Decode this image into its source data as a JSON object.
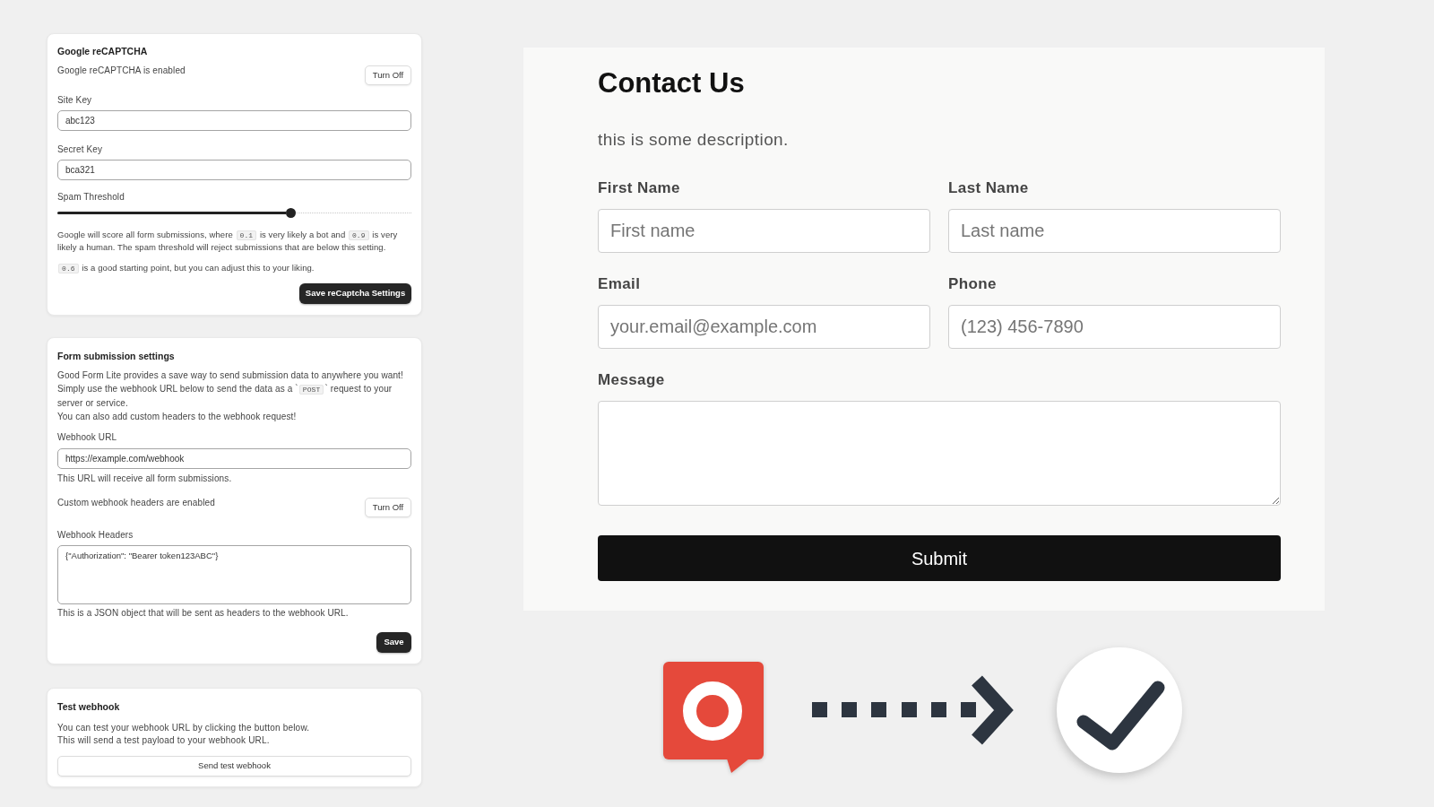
{
  "recaptcha": {
    "title": "Google reCAPTCHA",
    "status": "Google reCAPTCHA is enabled",
    "toggle_button": "Turn Off",
    "fields": [
      {
        "label": "Site Key",
        "value": "abc123"
      },
      {
        "label": "Secret Key",
        "value": "bca321"
      }
    ],
    "threshold": {
      "label": "Spam Threshold",
      "level": 0.66
    },
    "notes": [
      [
        {
          "kind": "text",
          "text": "Google will score all form submissions, where "
        },
        {
          "kind": "code",
          "text": "0.1"
        },
        {
          "kind": "text",
          "text": " is very likely a bot and "
        },
        {
          "kind": "code",
          "text": "0.9"
        },
        {
          "kind": "text",
          "text": " is very likely a human. The spam threshold will reject submissions that are below this setting."
        }
      ],
      [
        {
          "kind": "code",
          "text": "0.6"
        },
        {
          "kind": "text",
          "text": " is a good starting point, but you can adjust this to your liking."
        }
      ]
    ],
    "save_button": "Save reCaptcha Settings"
  },
  "form_submission": {
    "title": "Form submission settings",
    "intro": [
      [
        {
          "kind": "text",
          "text": "Good Form Lite provides a save way to send submission data to anywhere you want!"
        }
      ],
      [
        {
          "kind": "text",
          "text": "Simply use the webhook URL below to send the data as a `"
        },
        {
          "kind": "code",
          "text": "POST"
        },
        {
          "kind": "text",
          "text": "` request to your server or service."
        }
      ],
      [
        {
          "kind": "text",
          "text": "You can also add custom headers to the webhook request!"
        }
      ]
    ],
    "webhook_url": {
      "label": "Webhook URL",
      "value": "https://example.com/webhook",
      "hint": "This URL will receive all form submissions."
    },
    "headers_status": "Custom webhook headers are enabled",
    "toggle_button": "Turn Off",
    "webhook_headers": {
      "label": "Webhook Headers",
      "value": "{\"Authorization\": \"Bearer token123ABC\"}",
      "hint": "This is a JSON object that will be sent as headers to the webhook URL."
    },
    "save_button": "Save"
  },
  "test_webhook": {
    "title": "Test webhook",
    "lines": [
      "You can test your webhook URL by clicking the button below.",
      "This will send a test payload to your webhook URL."
    ],
    "button": "Send test webhook"
  },
  "contact_form": {
    "title": "Contact Us",
    "description": "this is some description.",
    "fields": [
      {
        "kind": "input",
        "label": "First Name",
        "placeholder": "First name"
      },
      {
        "kind": "input",
        "label": "Last Name",
        "placeholder": "Last name"
      },
      {
        "kind": "input",
        "label": "Email",
        "placeholder": "your.email@example.com"
      },
      {
        "kind": "input",
        "label": "Phone",
        "placeholder": "(123) 456-7890"
      },
      {
        "kind": "textarea",
        "label": "Message"
      }
    ],
    "submit_button": "Submit"
  }
}
